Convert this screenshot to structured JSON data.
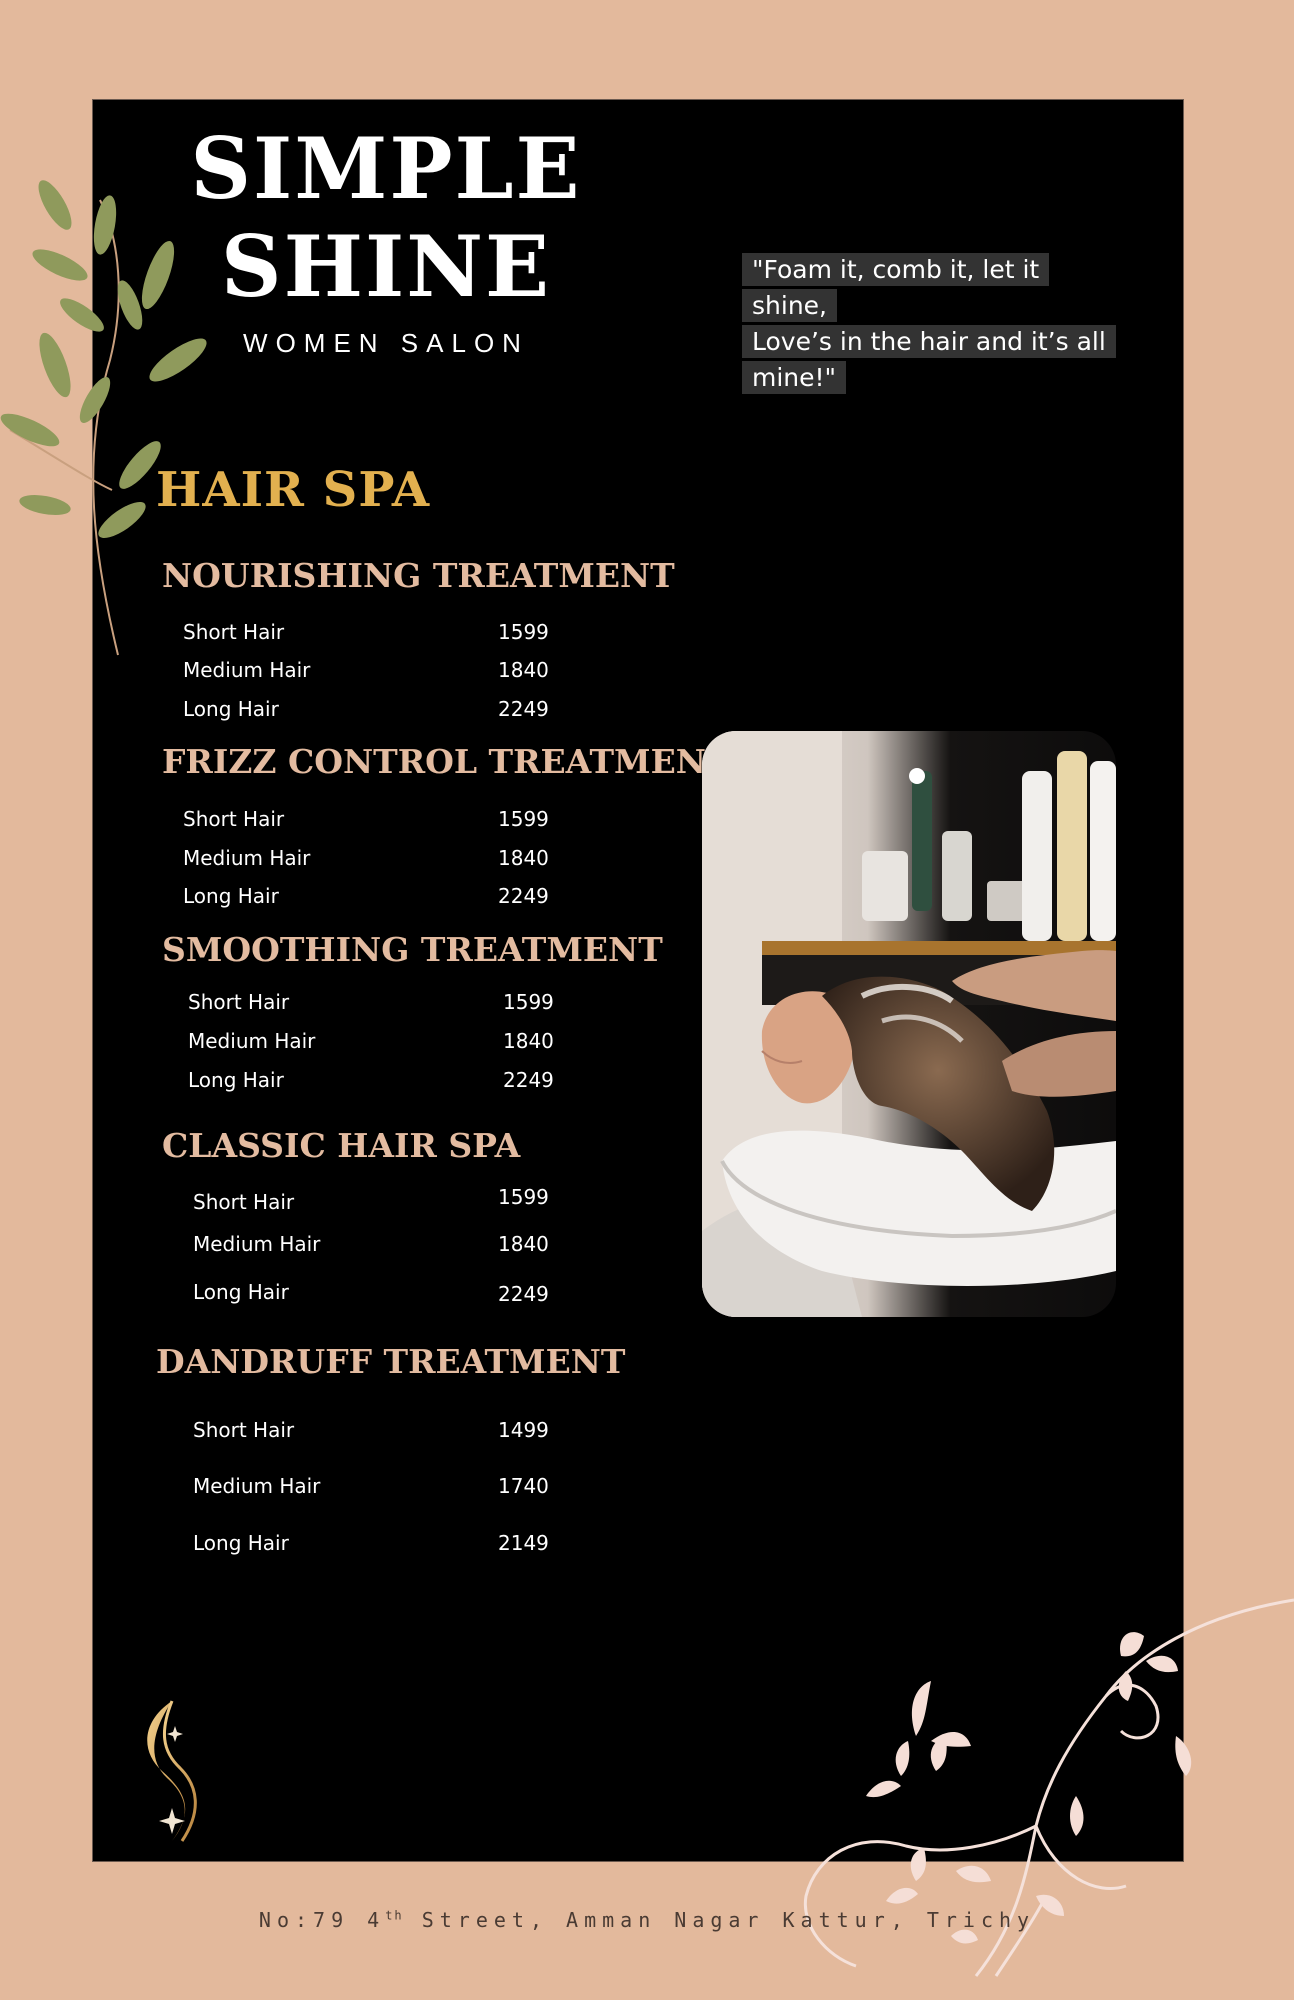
{
  "brand": {
    "title_line1": "SIMPLE",
    "title_line2": "SHINE",
    "subtitle": "WOMEN SALON"
  },
  "quote": {
    "line1": "\"Foam it, comb it, let it shine,",
    "line2": "Love’s in the hair and it’s all",
    "line3": "mine!\""
  },
  "section_title": "HAIR SPA",
  "categories": [
    {
      "title": "NOURISHING TREATMENT",
      "items": [
        {
          "name": "Short Hair",
          "price": "1599"
        },
        {
          "name": "Medium Hair",
          "price": "1840"
        },
        {
          "name": "Long Hair",
          "price": "2249"
        }
      ]
    },
    {
      "title": "FRIZZ CONTROL TREATMENT",
      "items": [
        {
          "name": "Short Hair",
          "price": "1599"
        },
        {
          "name": "Medium Hair",
          "price": "1840"
        },
        {
          "name": "Long Hair",
          "price": "2249"
        }
      ]
    },
    {
      "title": "SMOOTHING TREATMENT",
      "items": [
        {
          "name": "Short Hair",
          "price": "1599"
        },
        {
          "name": "Medium Hair",
          "price": "1840"
        },
        {
          "name": "Long Hair",
          "price": "2249"
        }
      ]
    },
    {
      "title": "CLASSIC HAIR SPA",
      "items": [
        {
          "name": "Short Hair",
          "price": "1599"
        },
        {
          "name": "Medium Hair",
          "price": "1840"
        },
        {
          "name": "Long Hair",
          "price": "2249"
        }
      ]
    },
    {
      "title": "DANDRUFF TREATMENT",
      "items": [
        {
          "name": "Short Hair",
          "price": "1499"
        },
        {
          "name": "Medium Hair",
          "price": "1740"
        },
        {
          "name": "Long Hair",
          "price": "2149"
        }
      ]
    }
  ],
  "address": {
    "prefix": "No:79 4",
    "superscript": "th",
    "suffix": " Street, Amman Nagar Kattur, Trichy"
  },
  "colors": {
    "background": "#e3b99c",
    "panel": "#000000",
    "section_title": "#e2b04f",
    "category_title": "#e3bba0"
  }
}
